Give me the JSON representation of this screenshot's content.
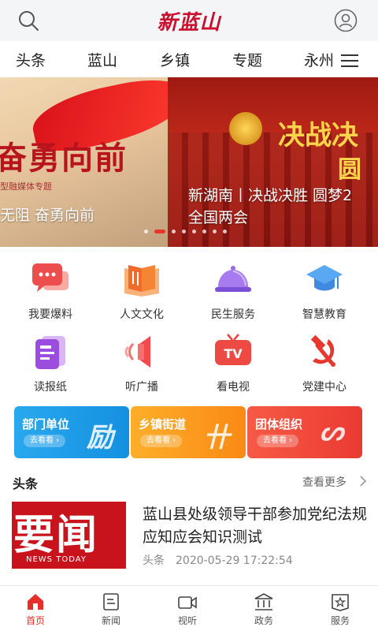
{
  "header": {
    "logo_text": "新蓝山",
    "search_icon": "search-icon",
    "user_icon": "user-icon"
  },
  "tabs": [
    "头条",
    "蓝山",
    "乡镇",
    "专题",
    "永州"
  ],
  "banner": {
    "left_big_text": "奋勇向前",
    "left_sub_text": "型融媒体专题",
    "left_caption": "无阻 奋勇向前",
    "right_big_text": "决战决",
    "right_big_text2": "圆",
    "right_caption_line1": "新湖南丨决战决胜 圆梦2",
    "right_caption_line2": "全国两会",
    "dots_total": 8,
    "active_dot": 1
  },
  "services": [
    {
      "label": "我要爆料",
      "icon": "chat-bubble-icon"
    },
    {
      "label": "人文文化",
      "icon": "open-book-icon"
    },
    {
      "label": "民生服务",
      "icon": "service-bell-icon"
    },
    {
      "label": "智慧教育",
      "icon": "graduation-cap-icon"
    },
    {
      "label": "读报纸",
      "icon": "newspaper-icon"
    },
    {
      "label": "听广播",
      "icon": "speaker-icon"
    },
    {
      "label": "看电视",
      "icon": "tv-icon"
    },
    {
      "label": "党建中心",
      "icon": "hammer-sickle-icon"
    }
  ],
  "cards": [
    {
      "title": "部门单位",
      "go": "去看看 ›",
      "color": "#1aa1e8"
    },
    {
      "title": "乡镇街道",
      "go": "去看看 ›",
      "color": "#fb9a1c"
    },
    {
      "title": "团体组织",
      "go": "去看看 ›",
      "color": "#f0473a"
    }
  ],
  "section": {
    "title": "头条",
    "more": "查看更多"
  },
  "news": {
    "thumb_text": "要闻",
    "thumb_sub": "NEWS TODAY",
    "headline": "蓝山县处级领导干部参加党纪法规应知应会知识测试",
    "source": "头条",
    "time": "2020-05-29 17:22:54"
  },
  "bottom_nav": [
    {
      "label": "首页",
      "icon": "home-icon",
      "active": true
    },
    {
      "label": "新闻",
      "icon": "news-icon",
      "active": false
    },
    {
      "label": "视听",
      "icon": "video-camera-icon",
      "active": false
    },
    {
      "label": "政务",
      "icon": "government-icon",
      "active": false
    },
    {
      "label": "服务",
      "icon": "service-icon",
      "active": false
    }
  ],
  "colors": {
    "accent": "#e5302a",
    "header_bg": "#f4f5f7"
  }
}
